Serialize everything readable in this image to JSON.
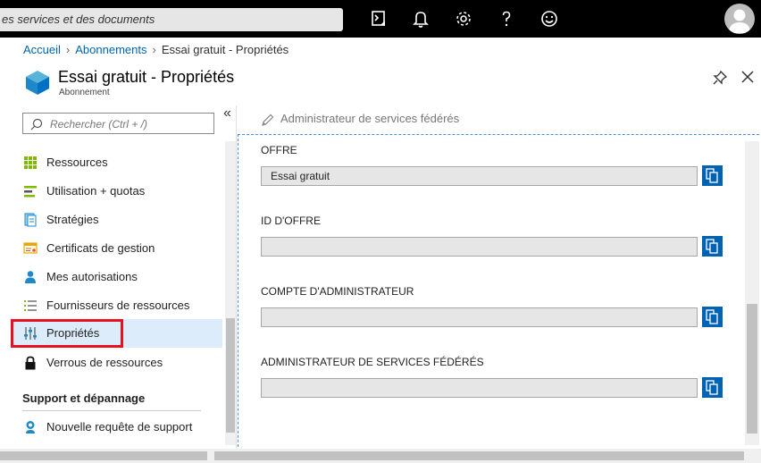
{
  "topbar": {
    "search_placeholder": "es services et des documents"
  },
  "breadcrumb": {
    "items": [
      "Accueil",
      "Abonnements",
      "Essai gratuit - Propriétés"
    ]
  },
  "header": {
    "title": "Essai gratuit - Propriétés",
    "subtitle": "Abonnement"
  },
  "sidebar": {
    "search_placeholder": "Rechercher (Ctrl + /)",
    "items": [
      {
        "label": "Ressources",
        "icon": "grid-icon"
      },
      {
        "label": "Utilisation + quotas",
        "icon": "usage-icon"
      },
      {
        "label": "Stratégies",
        "icon": "policy-icon"
      },
      {
        "label": "Certificats de gestion",
        "icon": "certificate-icon"
      },
      {
        "label": "Mes autorisations",
        "icon": "user-icon"
      },
      {
        "label": "Fournisseurs de ressources",
        "icon": "list-icon"
      },
      {
        "label": "Propriétés",
        "icon": "sliders-icon"
      },
      {
        "label": "Verrous de ressources",
        "icon": "lock-icon"
      }
    ],
    "section_title": "Support et dépannage",
    "support_items": [
      {
        "label": "Nouvelle requête de support",
        "icon": "support-icon"
      }
    ]
  },
  "main": {
    "command": "Administrateur de services fédérés",
    "fields": [
      {
        "label": "OFFRE",
        "value": "Essai gratuit"
      },
      {
        "label": "ID D'OFFRE",
        "value": ""
      },
      {
        "label": "COMPTE D'ADMINISTRATEUR",
        "value": ""
      },
      {
        "label": "ADMINISTRATEUR DE SERVICES FÉDÉRÉS",
        "value": ""
      }
    ]
  },
  "colors": {
    "accent": "#0063b1",
    "topbar": "#000000",
    "selected_bg": "#dcecfa",
    "highlight": "#e81123"
  }
}
